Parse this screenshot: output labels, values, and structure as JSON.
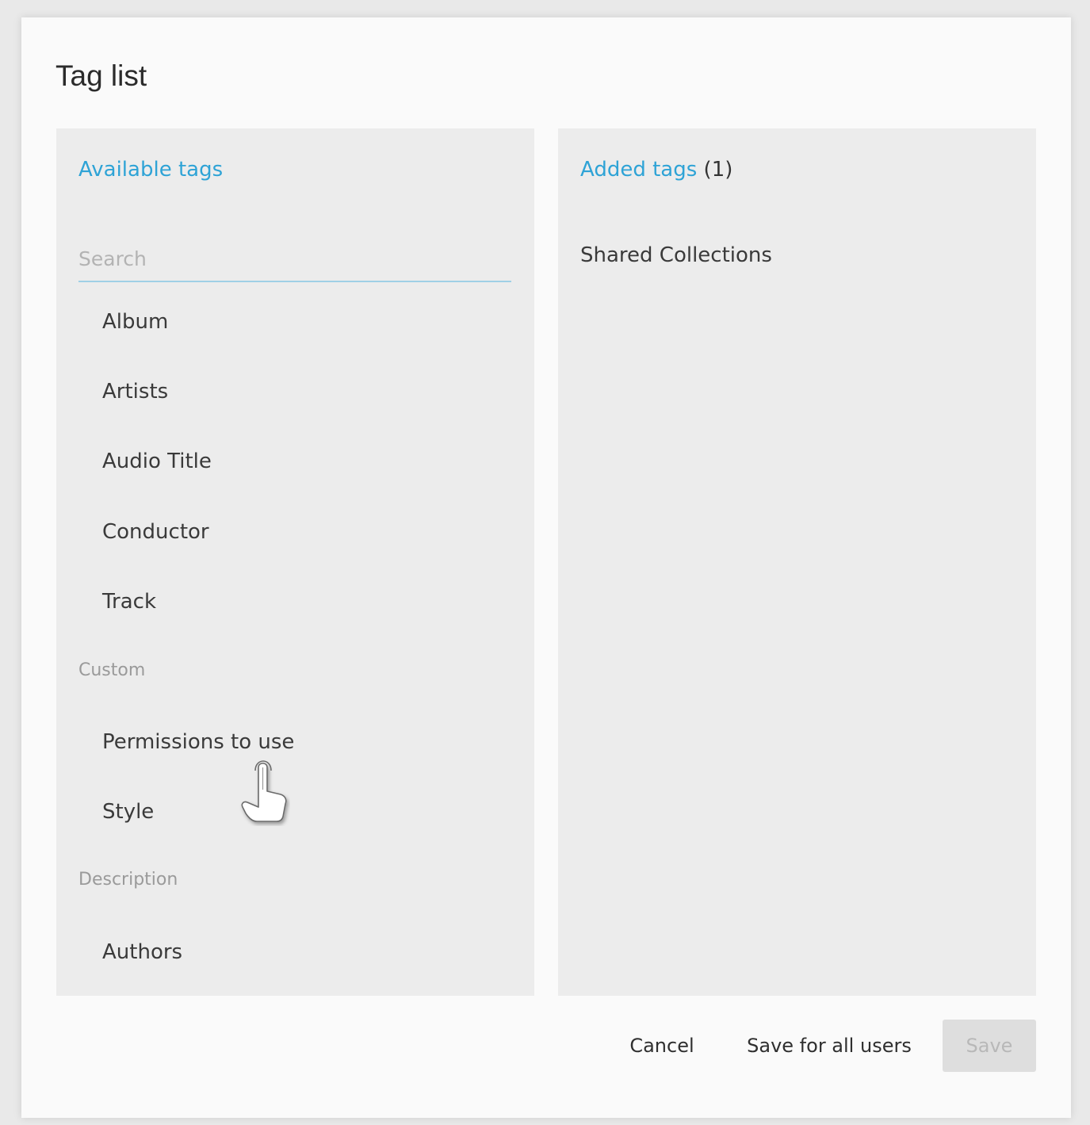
{
  "dialog": {
    "title": "Tag list"
  },
  "available": {
    "heading": "Available tags",
    "search_placeholder": "Search",
    "standard_tags": [
      "Album",
      "Artists",
      "Audio Title",
      "Conductor",
      "Track"
    ],
    "groups": [
      {
        "label": "Custom",
        "tags": [
          "Permissions to use",
          "Style"
        ]
      },
      {
        "label": "Description",
        "tags": [
          "Authors"
        ]
      }
    ]
  },
  "added": {
    "heading": "Added tags",
    "count": "(1)",
    "tags": [
      "Shared Collections"
    ]
  },
  "footer": {
    "cancel_label": "Cancel",
    "save_all_label": "Save for all users",
    "save_label": "Save"
  },
  "colors": {
    "accent": "#2ea3d6",
    "panel_bg": "#ececec",
    "disabled_button_bg": "#dedede"
  },
  "cursor": {
    "icon": "hand-pointer-icon"
  }
}
